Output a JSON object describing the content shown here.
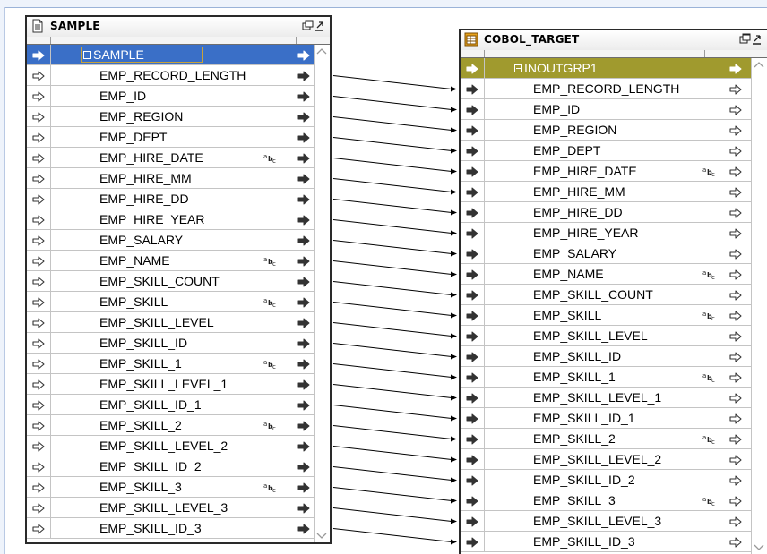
{
  "source": {
    "title": "SAMPLE",
    "group": "SAMPLE",
    "fields": [
      {
        "name": "EMP_RECORD_LENGTH",
        "text": false
      },
      {
        "name": "EMP_ID",
        "text": false
      },
      {
        "name": "EMP_REGION",
        "text": false
      },
      {
        "name": "EMP_DEPT",
        "text": false
      },
      {
        "name": "EMP_HIRE_DATE",
        "text": true
      },
      {
        "name": "EMP_HIRE_MM",
        "text": false
      },
      {
        "name": "EMP_HIRE_DD",
        "text": false
      },
      {
        "name": "EMP_HIRE_YEAR",
        "text": false
      },
      {
        "name": "EMP_SALARY",
        "text": false
      },
      {
        "name": "EMP_NAME",
        "text": true
      },
      {
        "name": "EMP_SKILL_COUNT",
        "text": false
      },
      {
        "name": "EMP_SKILL",
        "text": true
      },
      {
        "name": "EMP_SKILL_LEVEL",
        "text": false
      },
      {
        "name": "EMP_SKILL_ID",
        "text": false
      },
      {
        "name": "EMP_SKILL_1",
        "text": true
      },
      {
        "name": "EMP_SKILL_LEVEL_1",
        "text": false
      },
      {
        "name": "EMP_SKILL_ID_1",
        "text": false
      },
      {
        "name": "EMP_SKILL_2",
        "text": true
      },
      {
        "name": "EMP_SKILL_LEVEL_2",
        "text": false
      },
      {
        "name": "EMP_SKILL_ID_2",
        "text": false
      },
      {
        "name": "EMP_SKILL_3",
        "text": true
      },
      {
        "name": "EMP_SKILL_LEVEL_3",
        "text": false
      },
      {
        "name": "EMP_SKILL_ID_3",
        "text": false
      }
    ]
  },
  "target": {
    "title": "COBOL_TARGET",
    "group": "INOUTGRP1",
    "fields": [
      {
        "name": "EMP_RECORD_LENGTH",
        "text": false
      },
      {
        "name": "EMP_ID",
        "text": false
      },
      {
        "name": "EMP_REGION",
        "text": false
      },
      {
        "name": "EMP_DEPT",
        "text": false
      },
      {
        "name": "EMP_HIRE_DATE",
        "text": true
      },
      {
        "name": "EMP_HIRE_MM",
        "text": false
      },
      {
        "name": "EMP_HIRE_DD",
        "text": false
      },
      {
        "name": "EMP_HIRE_YEAR",
        "text": false
      },
      {
        "name": "EMP_SALARY",
        "text": false
      },
      {
        "name": "EMP_NAME",
        "text": true
      },
      {
        "name": "EMP_SKILL_COUNT",
        "text": false
      },
      {
        "name": "EMP_SKILL",
        "text": true
      },
      {
        "name": "EMP_SKILL_LEVEL",
        "text": false
      },
      {
        "name": "EMP_SKILL_ID",
        "text": false
      },
      {
        "name": "EMP_SKILL_1",
        "text": true
      },
      {
        "name": "EMP_SKILL_LEVEL_1",
        "text": false
      },
      {
        "name": "EMP_SKILL_ID_1",
        "text": false
      },
      {
        "name": "EMP_SKILL_2",
        "text": true
      },
      {
        "name": "EMP_SKILL_LEVEL_2",
        "text": false
      },
      {
        "name": "EMP_SKILL_ID_2",
        "text": false
      },
      {
        "name": "EMP_SKILL_3",
        "text": true
      },
      {
        "name": "EMP_SKILL_LEVEL_3",
        "text": false
      },
      {
        "name": "EMP_SKILL_ID_3",
        "text": false
      }
    ]
  },
  "text_type_badge": "abc",
  "colors": {
    "source_selected_row": "#3a6fc7",
    "target_selected_row": "#a09a2e",
    "port_arrow": "#333333",
    "link_line": "#000000"
  },
  "icons": {
    "source_title": "flat-file-source-icon",
    "target_title": "target-definition-icon",
    "title_buttons": "restore-window-icon"
  }
}
